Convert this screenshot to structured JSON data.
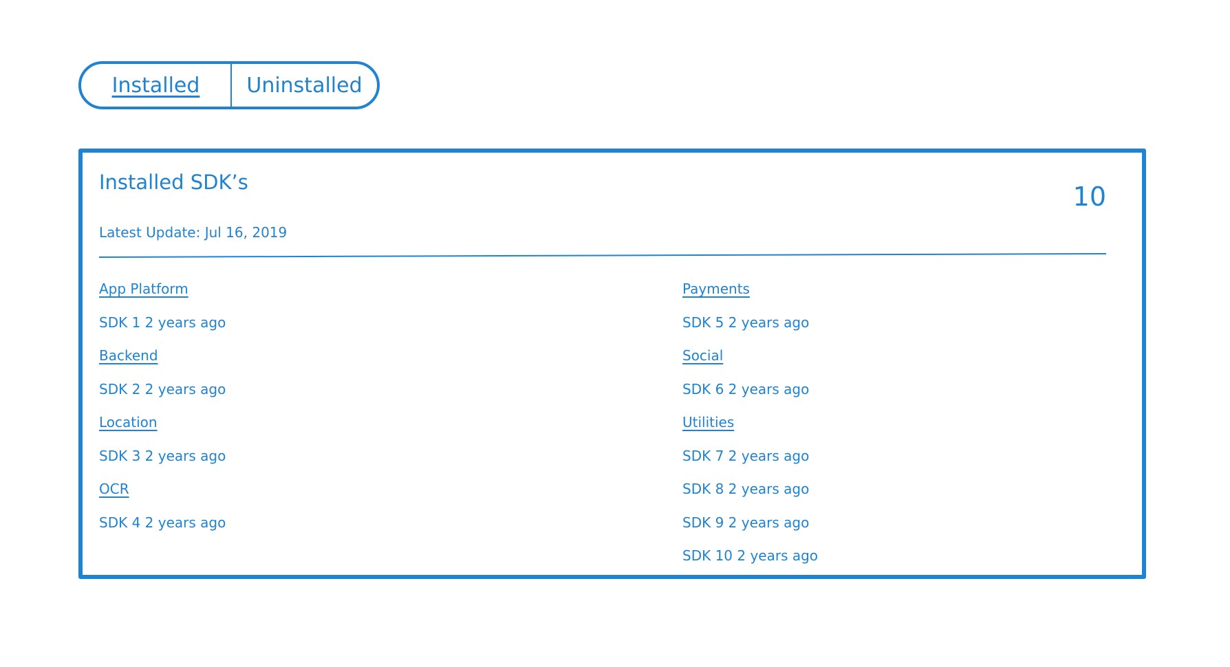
{
  "tabs": {
    "installed": "Installed",
    "uninstalled": "Uninstalled"
  },
  "card": {
    "title": "Installed SDK’s",
    "count": "10",
    "latest_update": "Latest Update: Jul 16, 2019"
  },
  "left_column": [
    {
      "type": "category",
      "text": "App Platform"
    },
    {
      "type": "sdk",
      "text": "SDK 1 2 years ago"
    },
    {
      "type": "category",
      "text": "Backend"
    },
    {
      "type": "sdk",
      "text": "SDK 2 2 years ago"
    },
    {
      "type": "category",
      "text": "Location"
    },
    {
      "type": "sdk",
      "text": "SDK 3 2 years ago"
    },
    {
      "type": "category",
      "text": "OCR"
    },
    {
      "type": "sdk",
      "text": "SDK 4 2 years ago"
    }
  ],
  "right_column": [
    {
      "type": "category",
      "text": "Payments"
    },
    {
      "type": "sdk",
      "text": "SDK 5 2 years ago"
    },
    {
      "type": "category",
      "text": "Social"
    },
    {
      "type": "sdk",
      "text": "SDK 6 2 years ago"
    },
    {
      "type": "category",
      "text": "Utilities"
    },
    {
      "type": "sdk",
      "text": "SDK 7 2 years ago"
    },
    {
      "type": "sdk",
      "text": "SDK 8 2 years ago"
    },
    {
      "type": "sdk",
      "text": "SDK 9 2 years ago"
    },
    {
      "type": "sdk",
      "text": "SDK 10 2 years ago"
    }
  ],
  "colors": {
    "accent": "#1f83d1",
    "background": "#ffffff"
  }
}
